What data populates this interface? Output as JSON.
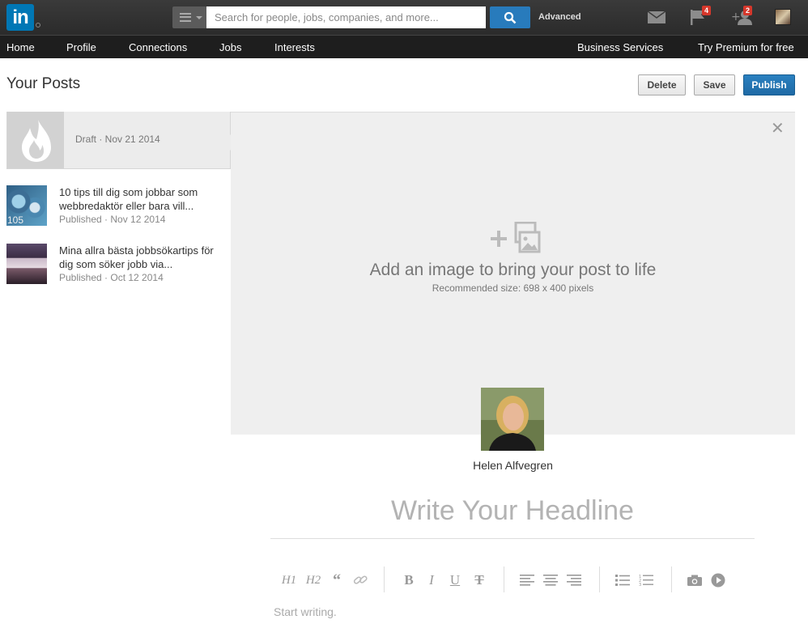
{
  "topbar": {
    "logo_text": "in",
    "search_placeholder": "Search for people, jobs, companies, and more...",
    "advanced_label": "Advanced",
    "notifications_badge": "4",
    "invitations_badge": "2",
    "icons": [
      "menu-icon",
      "search-icon",
      "messages-icon",
      "flag-icon",
      "add-connection-icon",
      "avatar"
    ]
  },
  "nav": {
    "items": [
      "Home",
      "Profile",
      "Connections",
      "Jobs",
      "Interests"
    ],
    "business": "Business Services",
    "premium": "Try Premium for free"
  },
  "header": {
    "title": "Your Posts",
    "delete_label": "Delete",
    "save_label": "Save",
    "publish_label": "Publish"
  },
  "sidebar": {
    "draft": {
      "label": "Draft · Nov 21 2014"
    },
    "posts": [
      {
        "title": "10 tips till dig som jobbar som webbredaktör eller bara vill...",
        "meta": "Published · Nov 12 2014",
        "thumb_label": "105"
      },
      {
        "title": "Mina allra bästa jobbsökartips för dig som söker jobb via...",
        "meta": "Published · Oct 12 2014"
      }
    ]
  },
  "editor": {
    "add_image_text": "Add an image to bring your post to life",
    "recommended_size": "Recommended size: 698 x 400 pixels",
    "author_name": "Helen Alfvegren",
    "headline_placeholder": "Write Your Headline",
    "body_placeholder": "Start writing.",
    "toolbar": [
      "H1",
      "H2",
      "“",
      "link",
      "B",
      "I",
      "U",
      "T",
      "align-left",
      "align-center",
      "align-right",
      "bullet-list",
      "numbered-list",
      "camera",
      "video"
    ]
  },
  "colors": {
    "brand": "#0077b5",
    "publish": "#1f6aa5",
    "topbar": "#2b2b2b",
    "badge": "#d6372b"
  }
}
